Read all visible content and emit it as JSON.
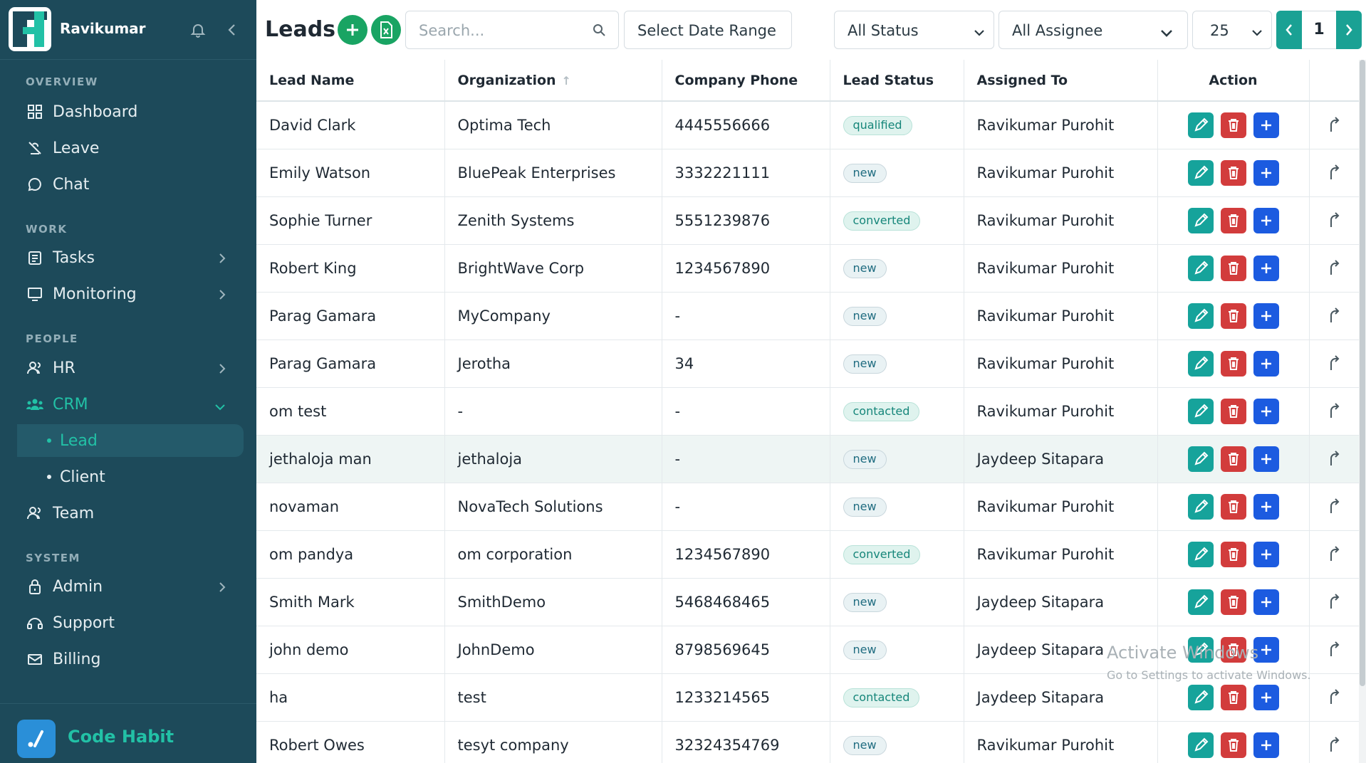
{
  "app": {
    "user_name": "Ravikumar",
    "company_name": "Code Habit"
  },
  "sidebar": {
    "sections": [
      {
        "title": "OVERVIEW"
      },
      {
        "title": "WORK"
      },
      {
        "title": "PEOPLE"
      },
      {
        "title": "SYSTEM"
      }
    ],
    "items": {
      "dashboard": "Dashboard",
      "leave": "Leave",
      "chat": "Chat",
      "tasks": "Tasks",
      "monitoring": "Monitoring",
      "hr": "HR",
      "crm": "CRM",
      "lead": "Lead",
      "client": "Client",
      "team": "Team",
      "admin": "Admin",
      "support": "Support",
      "billing": "Billing"
    }
  },
  "toolbar": {
    "title": "Leads",
    "search_placeholder": "Search...",
    "date_range": "Select Date Range",
    "status_filter": "All Status",
    "assignee_filter": "All Assignee",
    "page_size": "25",
    "current_page": "1"
  },
  "table": {
    "headers": [
      "Lead Name",
      "Organization",
      "Company Phone",
      "Lead Status",
      "Assigned To",
      "Action"
    ],
    "rows": [
      {
        "name": "David Clark",
        "org": "Optima Tech",
        "phone": "4445556666",
        "status": "qualified",
        "assigned": "Ravikumar Purohit"
      },
      {
        "name": "Emily Watson",
        "org": "BluePeak Enterprises",
        "phone": "3332221111",
        "status": "new",
        "assigned": "Ravikumar Purohit"
      },
      {
        "name": "Sophie Turner",
        "org": "Zenith Systems",
        "phone": "5551239876",
        "status": "converted",
        "assigned": "Ravikumar Purohit"
      },
      {
        "name": "Robert King",
        "org": "BrightWave Corp",
        "phone": "1234567890",
        "status": "new",
        "assigned": "Ravikumar Purohit"
      },
      {
        "name": "Parag Gamara",
        "org": "MyCompany",
        "phone": "-",
        "status": "new",
        "assigned": "Ravikumar Purohit"
      },
      {
        "name": "Parag Gamara",
        "org": "Jerotha",
        "phone": "34",
        "status": "new",
        "assigned": "Ravikumar Purohit"
      },
      {
        "name": "om test",
        "org": "-",
        "phone": "-",
        "status": "contacted",
        "assigned": "Ravikumar Purohit"
      },
      {
        "name": "jethaloja man",
        "org": "jethaloja",
        "phone": "-",
        "status": "new",
        "assigned": "Jaydeep Sitapara"
      },
      {
        "name": "novaman",
        "org": "NovaTech Solutions",
        "phone": "-",
        "status": "new",
        "assigned": "Ravikumar Purohit"
      },
      {
        "name": "om pandya",
        "org": "om corporation",
        "phone": "1234567890",
        "status": "converted",
        "assigned": "Ravikumar Purohit"
      },
      {
        "name": "Smith Mark",
        "org": "SmithDemo",
        "phone": "5468468465",
        "status": "new",
        "assigned": "Jaydeep Sitapara"
      },
      {
        "name": "john demo",
        "org": "JohnDemo",
        "phone": "8798569645",
        "status": "new",
        "assigned": "Jaydeep Sitapara"
      },
      {
        "name": "ha",
        "org": "test",
        "phone": "1233214565",
        "status": "contacted",
        "assigned": "Jaydeep Sitapara"
      },
      {
        "name": "Robert Owes",
        "org": "tesyt company",
        "phone": "32324354769",
        "status": "new",
        "assigned": "Ravikumar Purohit"
      }
    ]
  },
  "watermark": {
    "line1": "Activate Windows",
    "line2": "Go to Settings to activate Windows."
  },
  "colors": {
    "sidebar_bg": "#1d4a5a",
    "accent": "#22c1a6",
    "edit_button": "#16a39b",
    "delete_button": "#d23c3c",
    "add_button": "#1c5be0",
    "primary_green": "#19a463"
  }
}
